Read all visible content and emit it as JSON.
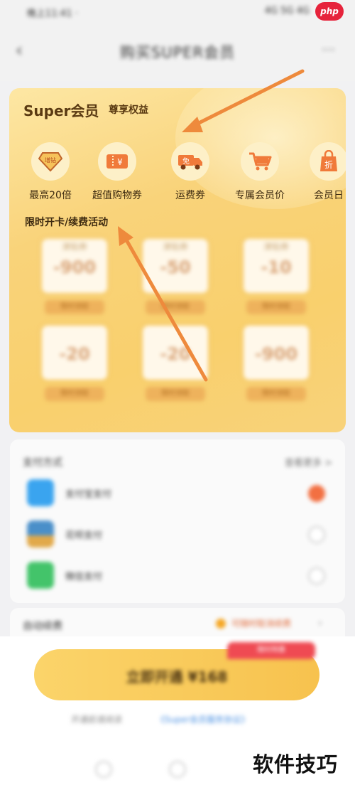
{
  "status_bar": {
    "left": "晚上11:41 ·",
    "right": "4G 5G 4G",
    "php_badge": "php"
  },
  "nav": {
    "back_icon": "chevron-left-icon",
    "title": "购买SUPER会员",
    "more_icon": "more-icon"
  },
  "card": {
    "title": "Super会员",
    "subtitle": "尊享权益",
    "benefits": [
      {
        "icon": "diamond-icon",
        "glyph": "增钻",
        "label": "最高20倍"
      },
      {
        "icon": "ticket-icon",
        "glyph": "¥",
        "label": "超值购物券"
      },
      {
        "icon": "delivery-truck-icon",
        "glyph": "免",
        "label": "运费券"
      },
      {
        "icon": "cart-icon",
        "glyph": "🛒",
        "label": "专属会员价"
      },
      {
        "icon": "discount-bag-icon",
        "glyph": "折",
        "label": "会员日"
      }
    ],
    "section_label": "限时开卡/续费活动",
    "coupons": [
      {
        "title": "津贴券",
        "value": "-900",
        "button": "限时领取"
      },
      {
        "title": "津贴券",
        "value": "-50",
        "button": "限时领取"
      },
      {
        "title": "津贴券",
        "value": "-10",
        "button": "限时领取"
      },
      {
        "title": "",
        "value": "-20",
        "button": "限时领取"
      },
      {
        "title": "",
        "value": "-20",
        "button": "限时领取"
      },
      {
        "title": "",
        "value": "-900",
        "button": "限时领取"
      }
    ]
  },
  "payment": {
    "title": "支付方式",
    "link": "查看更多 >",
    "methods": [
      {
        "icon": "alipay-icon",
        "color": "#3aa4ef",
        "label": "支付宝支付",
        "selected": true
      },
      {
        "icon": "card-icon",
        "color": "#4a8fc9",
        "label": "花呗支付",
        "selected": false
      },
      {
        "icon": "wechat-icon",
        "color": "#43c46a",
        "label": "微信支付",
        "selected": false
      }
    ]
  },
  "auto_renew": {
    "label": "自动续费",
    "note": "可随时取消续费",
    "chevron": "chevron-right-icon"
  },
  "bottom": {
    "open_button": "立即开通 ¥168",
    "promo_tag": "限时特惠",
    "agree_text": "开通前请阅读",
    "agree_link": "《Super会员服务协议》",
    "watermark": "软件技巧"
  },
  "colors": {
    "card_gold": "#f9d06d",
    "button_gold": "#f7c24e",
    "accent_red": "#ef4a53",
    "radio_on": "#f27042",
    "arrow_orange": "#ee8a3c"
  }
}
